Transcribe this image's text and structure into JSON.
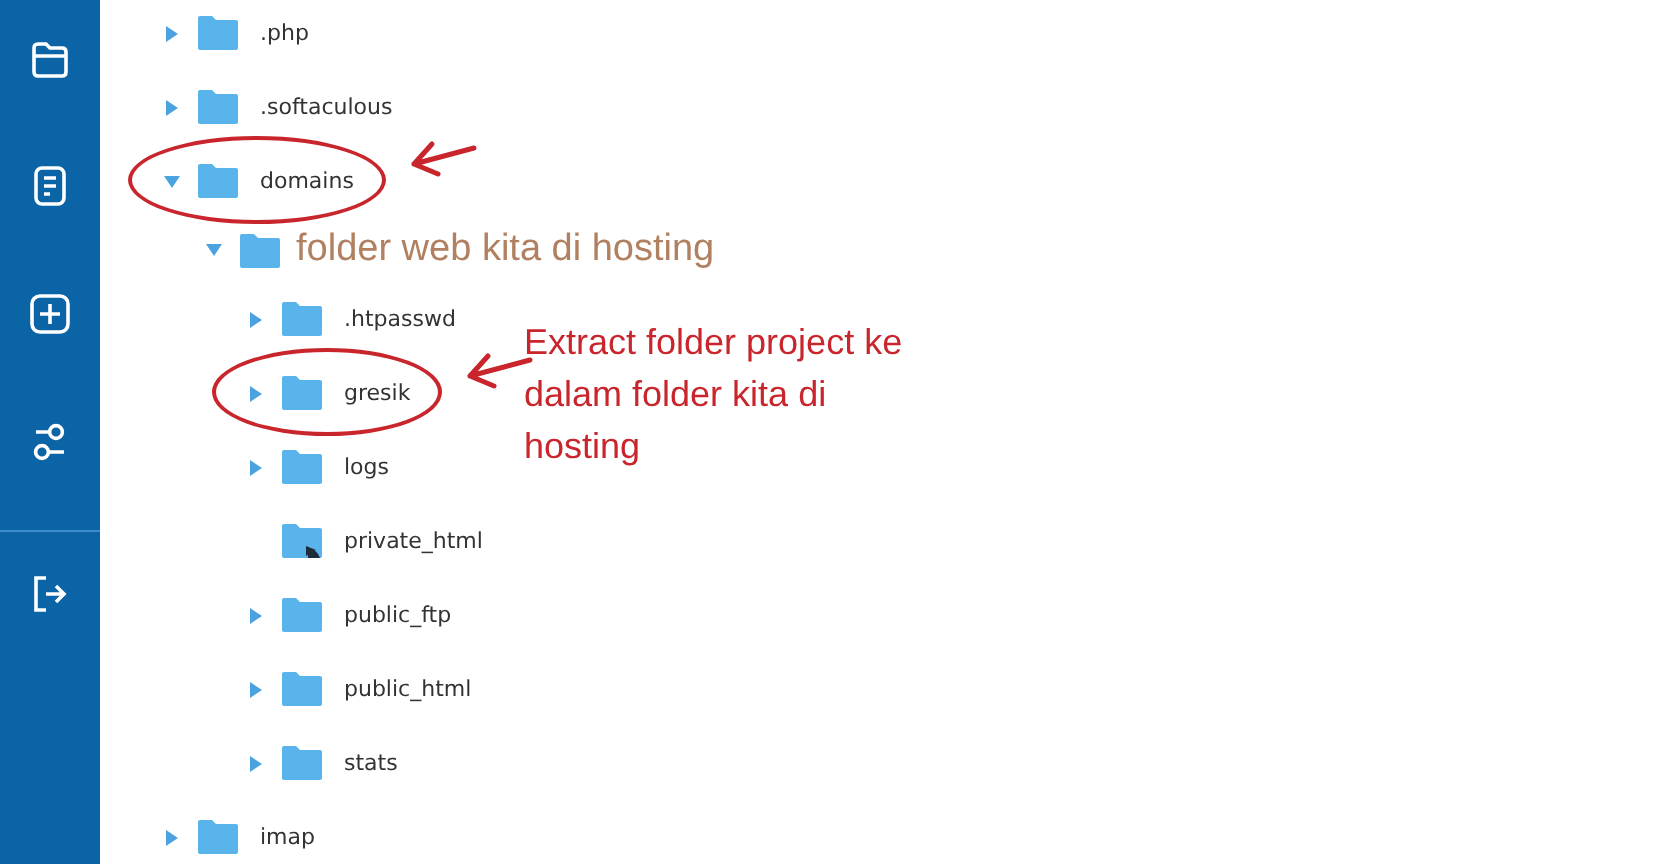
{
  "tree": [
    {
      "label": ".php",
      "kind": "folder",
      "expanded": false,
      "circled": false
    },
    {
      "label": ".softaculous",
      "kind": "folder",
      "expanded": false,
      "circled": false
    },
    {
      "label": "domains",
      "kind": "folder",
      "expanded": true,
      "circled": true,
      "children": [
        {
          "label": "folder web kita di hosting",
          "kind": "note-folder",
          "expanded": true,
          "circled": false,
          "children": [
            {
              "label": ".htpasswd",
              "kind": "folder",
              "expanded": false,
              "circled": false
            },
            {
              "label": "gresik",
              "kind": "folder",
              "expanded": false,
              "circled": true
            },
            {
              "label": "logs",
              "kind": "folder",
              "expanded": false,
              "circled": false
            },
            {
              "label": "private_html",
              "kind": "symlink",
              "circled": false
            },
            {
              "label": "public_ftp",
              "kind": "folder",
              "expanded": false,
              "circled": false
            },
            {
              "label": "public_html",
              "kind": "folder",
              "expanded": false,
              "circled": false
            },
            {
              "label": "stats",
              "kind": "folder",
              "expanded": false,
              "circled": false
            }
          ]
        }
      ]
    },
    {
      "label": "imap",
      "kind": "folder",
      "expanded": false,
      "circled": false
    }
  ],
  "note": "Extract folder project ke dalam folder kita di hosting"
}
